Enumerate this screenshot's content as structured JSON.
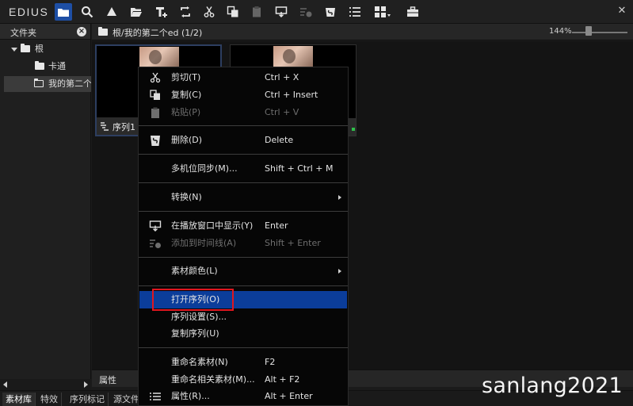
{
  "app": {
    "logo": "EDIUS"
  },
  "toolbar": {
    "buttons": [
      {
        "name": "folder-view-icon"
      },
      {
        "name": "search-icon"
      },
      {
        "name": "upload-icon"
      },
      {
        "name": "open-folder-icon"
      },
      {
        "name": "add-title-icon"
      },
      {
        "name": "replace-icon"
      },
      {
        "name": "cut-icon"
      },
      {
        "name": "copy-icon"
      },
      {
        "name": "paste-icon"
      },
      {
        "name": "show-player-icon"
      },
      {
        "name": "add-timeline-icon"
      },
      {
        "name": "delete-icon"
      },
      {
        "name": "list-view-icon"
      },
      {
        "name": "thumbnail-view-icon"
      },
      {
        "name": "toolbox-icon"
      }
    ],
    "close_label": "✕"
  },
  "folder_panel": {
    "title": "文件夹",
    "tree": [
      {
        "label": "根",
        "level": 0,
        "expanded": true
      },
      {
        "label": "卡通",
        "level": 1
      },
      {
        "label": "我的第二个ed",
        "level": 1,
        "selected": true
      }
    ]
  },
  "bin": {
    "path": "根/我的第二个ed (1/2)",
    "zoom": "144%",
    "zoom_level": 0.3,
    "clips": [
      {
        "name": "序列1",
        "selected": true
      },
      {
        "name": ""
      }
    ]
  },
  "properties_bar": {
    "title": "属性"
  },
  "bottom_tabs": [
    {
      "label": "素材库",
      "active": true
    },
    {
      "label": "特效"
    },
    {
      "label": "序列标记"
    },
    {
      "label": "源文件"
    }
  ],
  "context_menu": {
    "items": {
      "cut": {
        "label": "剪切(T)",
        "shortcut": "Ctrl + X"
      },
      "copy": {
        "label": "复制(C)",
        "shortcut": "Ctrl + Insert"
      },
      "paste": {
        "label": "粘贴(P)",
        "shortcut": "Ctrl + V",
        "disabled": true
      },
      "delete": {
        "label": "删除(D)",
        "shortcut": "Delete"
      },
      "multicam_sync": {
        "label": "多机位同步(M)...",
        "shortcut": "Shift + Ctrl + M"
      },
      "convert": {
        "label": "转换(N)"
      },
      "show_in_player": {
        "label": "在播放窗口中显示(Y)",
        "shortcut": "Enter"
      },
      "add_to_timeline": {
        "label": "添加到时间线(A)",
        "shortcut": "Shift + Enter",
        "disabled": true
      },
      "clip_color": {
        "label": "素材颜色(L)"
      },
      "open_sequence": {
        "label": "打开序列(O)",
        "highlighted": true
      },
      "sequence_settings": {
        "label": "序列设置(S)..."
      },
      "duplicate_sequence": {
        "label": "复制序列(U)"
      },
      "rename_clip": {
        "label": "重命名素材(N)",
        "shortcut": "F2"
      },
      "rename_related": {
        "label": "重命名相关素材(M)...",
        "shortcut": "Alt + F2"
      },
      "properties": {
        "label": "属性(R)...",
        "shortcut": "Alt + Enter"
      }
    }
  },
  "watermark": "sanlang2021",
  "colors": {
    "accent": "#0b3d9a",
    "highlight_box": "#e0161f",
    "toolbar_active": "#1e4fa5"
  }
}
